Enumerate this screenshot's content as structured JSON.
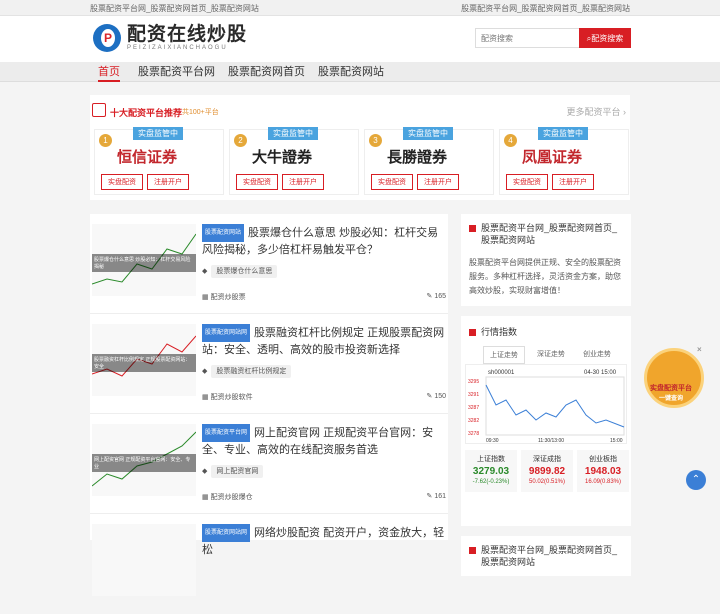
{
  "topbar": {
    "left": "股票配资平台网_股票配资网首页_股票配资网站",
    "right": "股票配资平台网_股票配资网首页_股票配资网站"
  },
  "logo": {
    "title": "配资在线炒股",
    "pinyin": "PEIZIZAIXIANCHAOGU",
    "mark": "P"
  },
  "search": {
    "placeholder": "配资搜索",
    "button": "配资搜索"
  },
  "nav": [
    "首页",
    "股票配资平台网",
    "股票配资网首页",
    "股票配资网站"
  ],
  "recommend": {
    "title": "十大配资平台推荐",
    "count": "共100+平台",
    "more": "更多配资平台",
    "cards": [
      {
        "rank": "1",
        "badge": "实盘监管中",
        "name": "恒信证券",
        "btn1": "实盘配资",
        "btn2": "注册开户"
      },
      {
        "rank": "2",
        "badge": "实盘监管中",
        "name": "大牛證券",
        "btn1": "实盘配资",
        "btn2": "注册开户"
      },
      {
        "rank": "3",
        "badge": "实盘监管中",
        "name": "長勝證券",
        "btn1": "实盘配资",
        "btn2": "注册开户"
      },
      {
        "rank": "4",
        "badge": "实盘监管中",
        "name": "凤凰证券",
        "btn1": "实盘配资",
        "btn2": "注册开户"
      }
    ]
  },
  "articles": [
    {
      "tag": "股票配资网站",
      "title": "股票爆仓什么意思 炒股必知：杠杆交易风险揭秘，多少倍杠杆易触发平仓？",
      "keyword": "股票爆仓什么意思",
      "category": "配资炒股票",
      "views": "165",
      "thumb": "股票爆仓什么意思 炒股必知：杠杆交易风险揭秘"
    },
    {
      "tag": "股票配资网站网",
      "title": "股票融资杠杆比例规定 正规股票配资网站：安全、透明、高效的股市投资新选择",
      "keyword": "股票融资杠杆比例规定",
      "category": "配资炒股软件",
      "views": "150",
      "thumb": "股票融资杠杆比例规定 正规股票配资网站：安全"
    },
    {
      "tag": "股票配资平台网",
      "title": "网上配资官网 正规配资平台官网：安全、专业、高效的在线配资服务首选",
      "keyword": "网上配资官网",
      "category": "配资炒股爆仓",
      "views": "161",
      "thumb": "网上配资官网 正规配资平台官网：安全、专业"
    },
    {
      "tag": "股票配资网站网",
      "title": "网络炒股配资 配资开户，资金放大，轻松",
      "keyword": "",
      "category": "",
      "views": "",
      "thumb": ""
    }
  ],
  "sidebar": {
    "about_title": "股票配资平台网_股票配资网首页_股票配资网站",
    "about_text": "股票配资平台网提供正规、安全的股票配资服务。多种杠杆选择，灵活资金方案，助您高效炒股，实现财富增值！",
    "quotes_title": "行情指数",
    "tabs": [
      "上证走势",
      "深证走势",
      "创业走势"
    ],
    "chart_code": "sh000001",
    "chart_time": "04-30 15:00",
    "chart_left": "09:30",
    "chart_mid": "11:30/13:00",
    "chart_right": "15:00",
    "y_ticks": [
      "3295",
      "3291",
      "3287",
      "3282",
      "3278"
    ],
    "indices": [
      {
        "name": "上证指数",
        "price": "3279.03",
        "change": "-7.62(-0.23%)",
        "up": false
      },
      {
        "name": "深证成指",
        "price": "9899.82",
        "change": "50.02(0.51%)",
        "up": true
      },
      {
        "name": "创业板指",
        "price": "1948.03",
        "change": "16.09(0.83%)",
        "up": true
      }
    ]
  },
  "sidebar_more_title": "股票配资平台网_股票配资网首页_股票配资网站",
  "float_ad": {
    "label": "实盘配资平台",
    "sub": "一键查询",
    "close": "×"
  },
  "colors": {
    "accent": "#d81e24",
    "blue": "#3b7fd6",
    "green": "#2a8a2a"
  },
  "icons": {
    "back_to_top": "chevron-up-icon"
  }
}
